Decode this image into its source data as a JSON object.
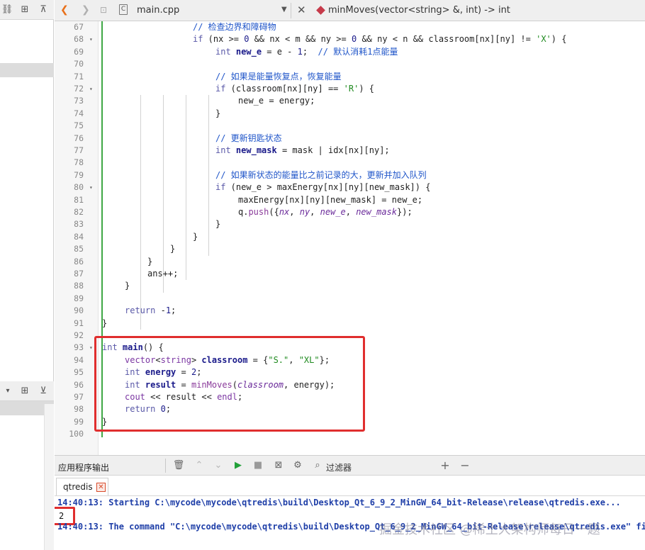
{
  "editor": {
    "file_name": "main.cpp",
    "function_signature": "minMoves(vector<string> &, int) -> int",
    "file_icon_glyph": "C"
  },
  "code_lines": [
    {
      "num": "67",
      "fold": "",
      "indent": 4,
      "html": "<span class=\"cm\">// 检查边界和障碍物</span>"
    },
    {
      "num": "68",
      "fold": "▾",
      "indent": 4,
      "html": "<span class=\"kw\">if</span> (nx &gt;= <span class=\"nm\">0</span> &amp;&amp; nx &lt; m &amp;&amp; ny &gt;= <span class=\"nm\">0</span> &amp;&amp; ny &lt; n &amp;&amp; classroom[nx][ny] != <span class=\"st\">'X'</span>) {"
    },
    {
      "num": "69",
      "fold": "",
      "indent": 5,
      "html": "<span class=\"kw\">int</span> <span class=\"vr\">new_e</span> = e - <span class=\"nm\">1</span>;  <span class=\"cm\">// 默认消耗1点能量</span>"
    },
    {
      "num": "70",
      "fold": "",
      "indent": 5,
      "html": ""
    },
    {
      "num": "71",
      "fold": "",
      "indent": 5,
      "html": "<span class=\"cm\">// 如果是能量恢复点，恢复能量</span>"
    },
    {
      "num": "72",
      "fold": "▾",
      "indent": 5,
      "html": "<span class=\"kw\">if</span> (classroom[nx][ny] == <span class=\"st\">'R'</span>) {"
    },
    {
      "num": "73",
      "fold": "",
      "indent": 6,
      "html": "new_e = energy;"
    },
    {
      "num": "74",
      "fold": "",
      "indent": 5,
      "html": "}"
    },
    {
      "num": "75",
      "fold": "",
      "indent": 5,
      "html": ""
    },
    {
      "num": "76",
      "fold": "",
      "indent": 5,
      "html": "<span class=\"cm\">// 更新钥匙状态</span>"
    },
    {
      "num": "77",
      "fold": "",
      "indent": 5,
      "html": "<span class=\"kw\">int</span> <span class=\"vr\">new_mask</span> = mask | idx[nx][ny];"
    },
    {
      "num": "78",
      "fold": "",
      "indent": 5,
      "html": ""
    },
    {
      "num": "79",
      "fold": "",
      "indent": 5,
      "html": "<span class=\"cm\">// 如果新状态的能量比之前记录的大，更新并加入队列</span>"
    },
    {
      "num": "80",
      "fold": "▾",
      "indent": 5,
      "html": "<span class=\"kw\">if</span> (new_e &gt; maxEnergy[nx][ny][new_mask]) {"
    },
    {
      "num": "81",
      "fold": "",
      "indent": 6,
      "html": "maxEnergy[nx][ny][new_mask] = new_e;"
    },
    {
      "num": "82",
      "fold": "",
      "indent": 6,
      "html": "q.<span class=\"fn\">push</span>({<span class=\"it\">nx</span>, <span class=\"it\">ny</span>, <span class=\"it\">new_e</span>, <span class=\"it\">new_mask</span>});"
    },
    {
      "num": "83",
      "fold": "",
      "indent": 5,
      "html": "}"
    },
    {
      "num": "84",
      "fold": "",
      "indent": 4,
      "html": "}"
    },
    {
      "num": "85",
      "fold": "",
      "indent": 3,
      "html": "}"
    },
    {
      "num": "86",
      "fold": "",
      "indent": 2,
      "html": "}"
    },
    {
      "num": "87",
      "fold": "",
      "indent": 2,
      "html": "ans++;"
    },
    {
      "num": "88",
      "fold": "",
      "indent": 1,
      "html": "}"
    },
    {
      "num": "89",
      "fold": "",
      "indent": 1,
      "html": ""
    },
    {
      "num": "90",
      "fold": "",
      "indent": 1,
      "html": "<span class=\"kw\">return</span> -<span class=\"nm\">1</span>;"
    },
    {
      "num": "91",
      "fold": "",
      "indent": 0,
      "html": "}"
    },
    {
      "num": "92",
      "fold": "",
      "indent": 0,
      "html": ""
    },
    {
      "num": "93",
      "fold": "▾",
      "indent": 0,
      "html": "<span class=\"kw\">int</span> <span class=\"vr\">main</span>() {"
    },
    {
      "num": "94",
      "fold": "",
      "indent": 1,
      "html": "<span class=\"ty\">vector</span>&lt;<span class=\"ty\">string</span>&gt; <span class=\"vr\">classroom</span> = {<span class=\"st\">\"S.\"</span>, <span class=\"st\">\"XL\"</span>};"
    },
    {
      "num": "95",
      "fold": "",
      "indent": 1,
      "html": "<span class=\"kw\">int</span> <span class=\"vr\">energy</span> = <span class=\"nm\">2</span>;"
    },
    {
      "num": "96",
      "fold": "",
      "indent": 1,
      "html": "<span class=\"kw\">int</span> <span class=\"vr\">result</span> = <span class=\"fn\">minMoves</span>(<span class=\"it\">classroom</span>, energy);"
    },
    {
      "num": "97",
      "fold": "",
      "indent": 1,
      "html": "<span class=\"ty\">cout</span> &lt;&lt; result &lt;&lt; <span class=\"ty\">endl</span>;"
    },
    {
      "num": "98",
      "fold": "",
      "indent": 1,
      "html": "<span class=\"kw\">return</span> <span class=\"nm\">0</span>;"
    },
    {
      "num": "99",
      "fold": "",
      "indent": 0,
      "html": "}"
    },
    {
      "num": "100",
      "fold": "",
      "indent": 0,
      "html": ""
    }
  ],
  "output": {
    "title": "应用程序输出",
    "filter_label": "过滤器",
    "tab_label": "qtredis",
    "lines": [
      "14:40:13: Starting C:\\mycode\\mycode\\qtredis\\build\\Desktop_Qt_6_9_2_MinGW_64_bit-Release\\release\\qtredis.exe...",
      "14:40:13: The command \"C:\\mycode\\mycode\\qtredis\\build\\Desktop_Qt_6_9_2_MinGW_64_bit-Release\\release\\qtredis.exe\" finished"
    ],
    "result_value": "2",
    "watermark": "掘金技术社区 @稀土大架构师每日一题"
  },
  "colors": {
    "accent_red": "#e02e2e",
    "change_bar_green": "#3fa845",
    "run_green": "#21a038",
    "comment_blue": "#1f55c9"
  }
}
